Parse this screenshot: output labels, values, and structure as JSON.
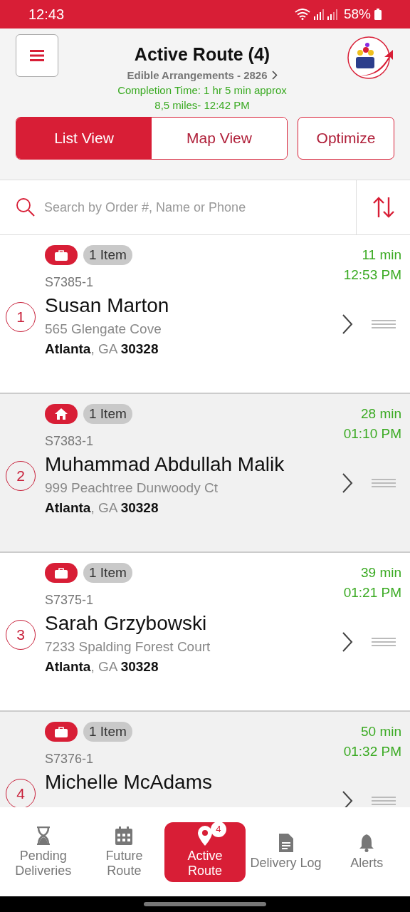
{
  "status_bar": {
    "time": "12:43",
    "battery": "58%"
  },
  "header": {
    "title": "Active Route (4)",
    "store": "Edible Arrangements - 2826",
    "completion": "Completion Time: 1 hr 5 min approx",
    "distance": "8,5 miles- 12:42 PM"
  },
  "tabs": [
    {
      "label": "List View",
      "selected": true
    },
    {
      "label": "Map View",
      "selected": false
    }
  ],
  "optimize_button": "Optimize",
  "search": {
    "placeholder": "Search by Order #, Name or Phone"
  },
  "stops": [
    {
      "number": "1",
      "kind": "business",
      "items": "1 Item",
      "order": "S7385-1",
      "name": "Susan Marton",
      "street": "565 Glengate Cove",
      "city": "**Atlanta**, GA **30328**",
      "eta": "11 min",
      "time": "12:53 PM"
    },
    {
      "number": "2",
      "kind": "home",
      "items": "1 Item",
      "order": "S7383-1",
      "name": "Muhammad Abdullah Malik",
      "street": "999 Peachtree Dunwoody Ct",
      "city": "**Atlanta**, GA **30328**",
      "eta": "28 min",
      "time": "01:10 PM"
    },
    {
      "number": "3",
      "kind": "business",
      "items": "1 Item",
      "order": "S7375-1",
      "name": "Sarah Grzybowski",
      "street": "7233 Spalding Forest Court",
      "city": "**Atlanta**, GA **30328**",
      "eta": "39 min",
      "time": "01:21 PM"
    },
    {
      "number": "4",
      "kind": "business",
      "items": "1 Item",
      "order": "S7376-1",
      "name": "Michelle McAdams",
      "eta": "50 min",
      "time": "01:32 PM"
    }
  ],
  "bottom_nav": [
    {
      "kind": "pending",
      "label": "Pending Deliveries",
      "selected": false
    },
    {
      "kind": "future",
      "label": "Future Route",
      "selected": false
    },
    {
      "kind": "active",
      "label": "Active Route",
      "badge": "4",
      "selected": true
    },
    {
      "kind": "log",
      "label": "Delivery Log",
      "selected": false
    },
    {
      "kind": "alerts",
      "label": "Alerts",
      "selected": false
    }
  ]
}
